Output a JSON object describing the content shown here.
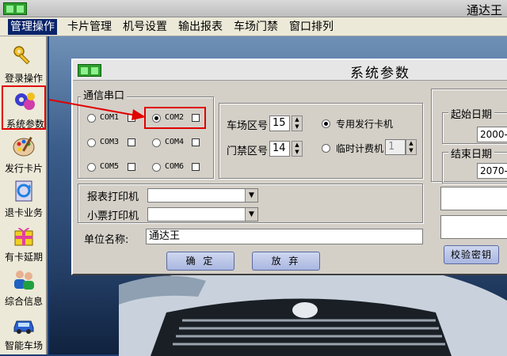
{
  "window": {
    "title": "通达王"
  },
  "menu": {
    "items": [
      "管理操作",
      "卡片管理",
      "机号设置",
      "输出报表",
      "车场门禁",
      "窗口排列"
    ]
  },
  "sidebar": {
    "items": [
      {
        "label": "登录操作",
        "icon": "key-icon"
      },
      {
        "label": "系统参数",
        "icon": "gears-icon"
      },
      {
        "label": "发行卡片",
        "icon": "palette-icon"
      },
      {
        "label": "退卡业务",
        "icon": "recycle-icon"
      },
      {
        "label": "有卡延期",
        "icon": "gift-icon"
      },
      {
        "label": "综合信息",
        "icon": "users-icon"
      },
      {
        "label": "智能车场",
        "icon": "car-icon"
      }
    ]
  },
  "dialog": {
    "title": "系统参数",
    "serial_group": "通信串口",
    "ports": [
      {
        "label": "COM1",
        "selected": false
      },
      {
        "label": "COM2",
        "selected": true
      },
      {
        "label": "COM3",
        "selected": false
      },
      {
        "label": "COM4",
        "selected": false
      },
      {
        "label": "COM5",
        "selected": false
      },
      {
        "label": "COM6",
        "selected": false
      }
    ],
    "parking_zone_label": "车场区号",
    "parking_zone_value": "15",
    "gate_zone_label": "门禁区号",
    "gate_zone_value": "14",
    "dedicated_reader_label": "专用发行卡机",
    "temp_meter_label": "临时计费机",
    "temp_meter_value": "1",
    "start_date_label": "起始日期",
    "start_date_value": "2000-",
    "end_date_label": "结束日期",
    "end_date_value": "2070-",
    "report_printer_label": "报表打印机",
    "receipt_printer_label": "小票打印机",
    "company_label": "单位名称:",
    "company_value": "通达王",
    "ok_label": "确 定",
    "cancel_label": "放 弃",
    "verify_label": "校验密钥"
  },
  "colors": {
    "highlight": "#e00000",
    "menu_active": "#0a246a"
  }
}
